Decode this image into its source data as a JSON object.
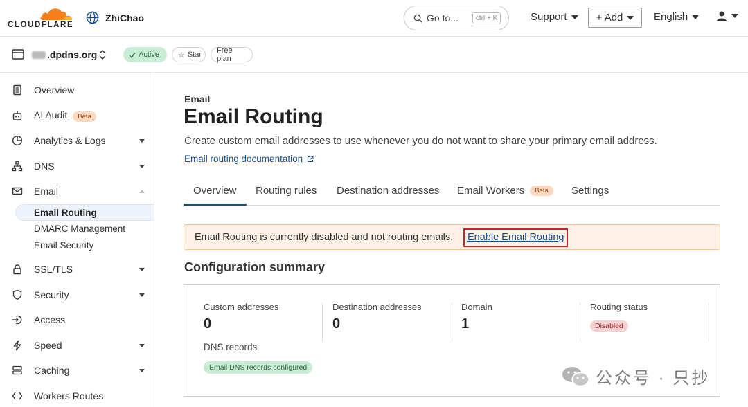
{
  "header": {
    "brand": "CLOUDFLARE",
    "account_name": "ZhiChao",
    "goto_label": "Go to...",
    "goto_shortcut": "ctrl + K",
    "support_label": "Support",
    "add_label": "+ Add",
    "language_label": "English"
  },
  "zone": {
    "domain": ".dpdns.org",
    "status": "Active",
    "star": "Star",
    "plan": "Free plan"
  },
  "sidebar": {
    "items": [
      {
        "label": "Overview",
        "icon": "document-icon"
      },
      {
        "label": "AI Audit",
        "badge": "Beta",
        "icon": "robot-icon"
      },
      {
        "label": "Analytics & Logs",
        "icon": "chart-icon"
      },
      {
        "label": "DNS",
        "icon": "network-icon"
      },
      {
        "label": "Email",
        "icon": "email-icon"
      },
      {
        "label": "SSL/TLS",
        "icon": "lock-icon"
      },
      {
        "label": "Security",
        "icon": "shield-icon"
      },
      {
        "label": "Access",
        "icon": "access-icon"
      },
      {
        "label": "Speed",
        "icon": "lightning-icon"
      },
      {
        "label": "Caching",
        "icon": "caching-icon"
      },
      {
        "label": "Workers Routes",
        "icon": "workers-icon"
      }
    ],
    "email_sub": [
      "Email Routing",
      "DMARC Management",
      "Email Security"
    ]
  },
  "main": {
    "breadcrumb": "Email",
    "title": "Email Routing",
    "description": "Create custom email addresses to use whenever you do not want to share your primary email address.",
    "doc_link": "Email routing documentation",
    "tabs": [
      "Overview",
      "Routing rules",
      "Destination addresses",
      "Email Workers",
      "Settings"
    ],
    "tab_badge": "Beta",
    "alert_text": "Email Routing is currently disabled and not routing emails.",
    "alert_link": "Enable Email Routing",
    "summary_title": "Configuration summary",
    "summary": {
      "custom_label": "Custom addresses",
      "custom_value": "0",
      "dest_label": "Destination addresses",
      "dest_value": "0",
      "domain_label": "Domain",
      "domain_value": "1",
      "status_label": "Routing status",
      "status_value": "Disabled",
      "dns_label": "DNS records",
      "dns_badge": "Email DNS records configured"
    }
  },
  "watermark": "公众号 · 只抄",
  "colors": {
    "accent_blue": "#1a4e8a",
    "brand_orange": "#f38020",
    "alert_bg": "#fdf1e5",
    "alert_border": "#c0292e",
    "active_green": "#c9ecd4"
  }
}
